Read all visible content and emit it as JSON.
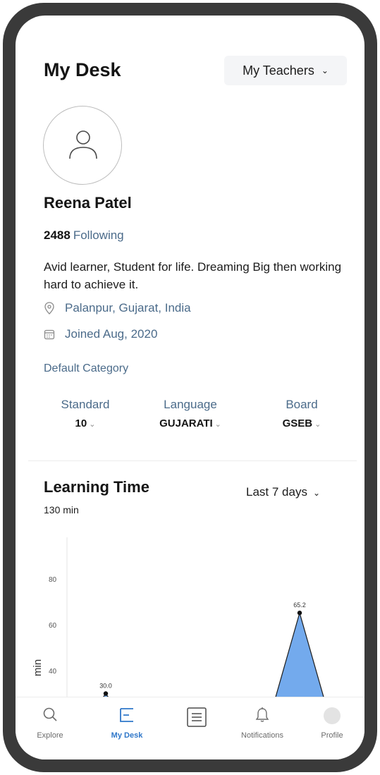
{
  "header": {
    "title": "My Desk",
    "teachers_dropdown": "My Teachers"
  },
  "profile": {
    "name": "Reena Patel",
    "following_count": "2488",
    "following_label": "Following",
    "bio": "Avid learner, Student for life. Dreaming Big then working hard to achieve it.",
    "location": "Palanpur, Gujarat, India",
    "joined": "Joined Aug, 2020"
  },
  "category": {
    "title": "Default Category",
    "items": [
      {
        "label": "Standard",
        "value": "10"
      },
      {
        "label": "Language",
        "value": "GUJARATI"
      },
      {
        "label": "Board",
        "value": "GSEB"
      }
    ]
  },
  "learning_time": {
    "title": "Learning Time",
    "total": "130 min",
    "range": "Last 7 days"
  },
  "chart_data": {
    "type": "area",
    "ylabel": "min",
    "xlabel": "",
    "title": "",
    "y_ticks": [
      40,
      60,
      80
    ],
    "ylim": [
      30,
      100
    ],
    "points": [
      {
        "x": 0,
        "y": 0
      },
      {
        "x": 1,
        "y": 30.0,
        "label": "30.0"
      },
      {
        "x": 2,
        "y": 0
      },
      {
        "x": 3,
        "y": 0
      },
      {
        "x": 4,
        "y": 0
      },
      {
        "x": 5,
        "y": 0
      },
      {
        "x": 6,
        "y": 65.2,
        "label": "65.2"
      },
      {
        "x": 7,
        "y": 0
      }
    ],
    "xlim": [
      0,
      7.4
    ],
    "fill_color": "#5b9bea",
    "line_color": "#1c1c1c"
  },
  "nav": {
    "items": [
      {
        "label": "Explore",
        "icon": "search-icon"
      },
      {
        "label": "My Desk",
        "icon": "desk-icon"
      },
      {
        "label": "",
        "icon": "list-icon"
      },
      {
        "label": "Notifications",
        "icon": "bell-icon"
      },
      {
        "label": "Profile",
        "icon": "avatar-icon"
      }
    ],
    "active": "My Desk",
    "active_color": "#2f77c9"
  }
}
